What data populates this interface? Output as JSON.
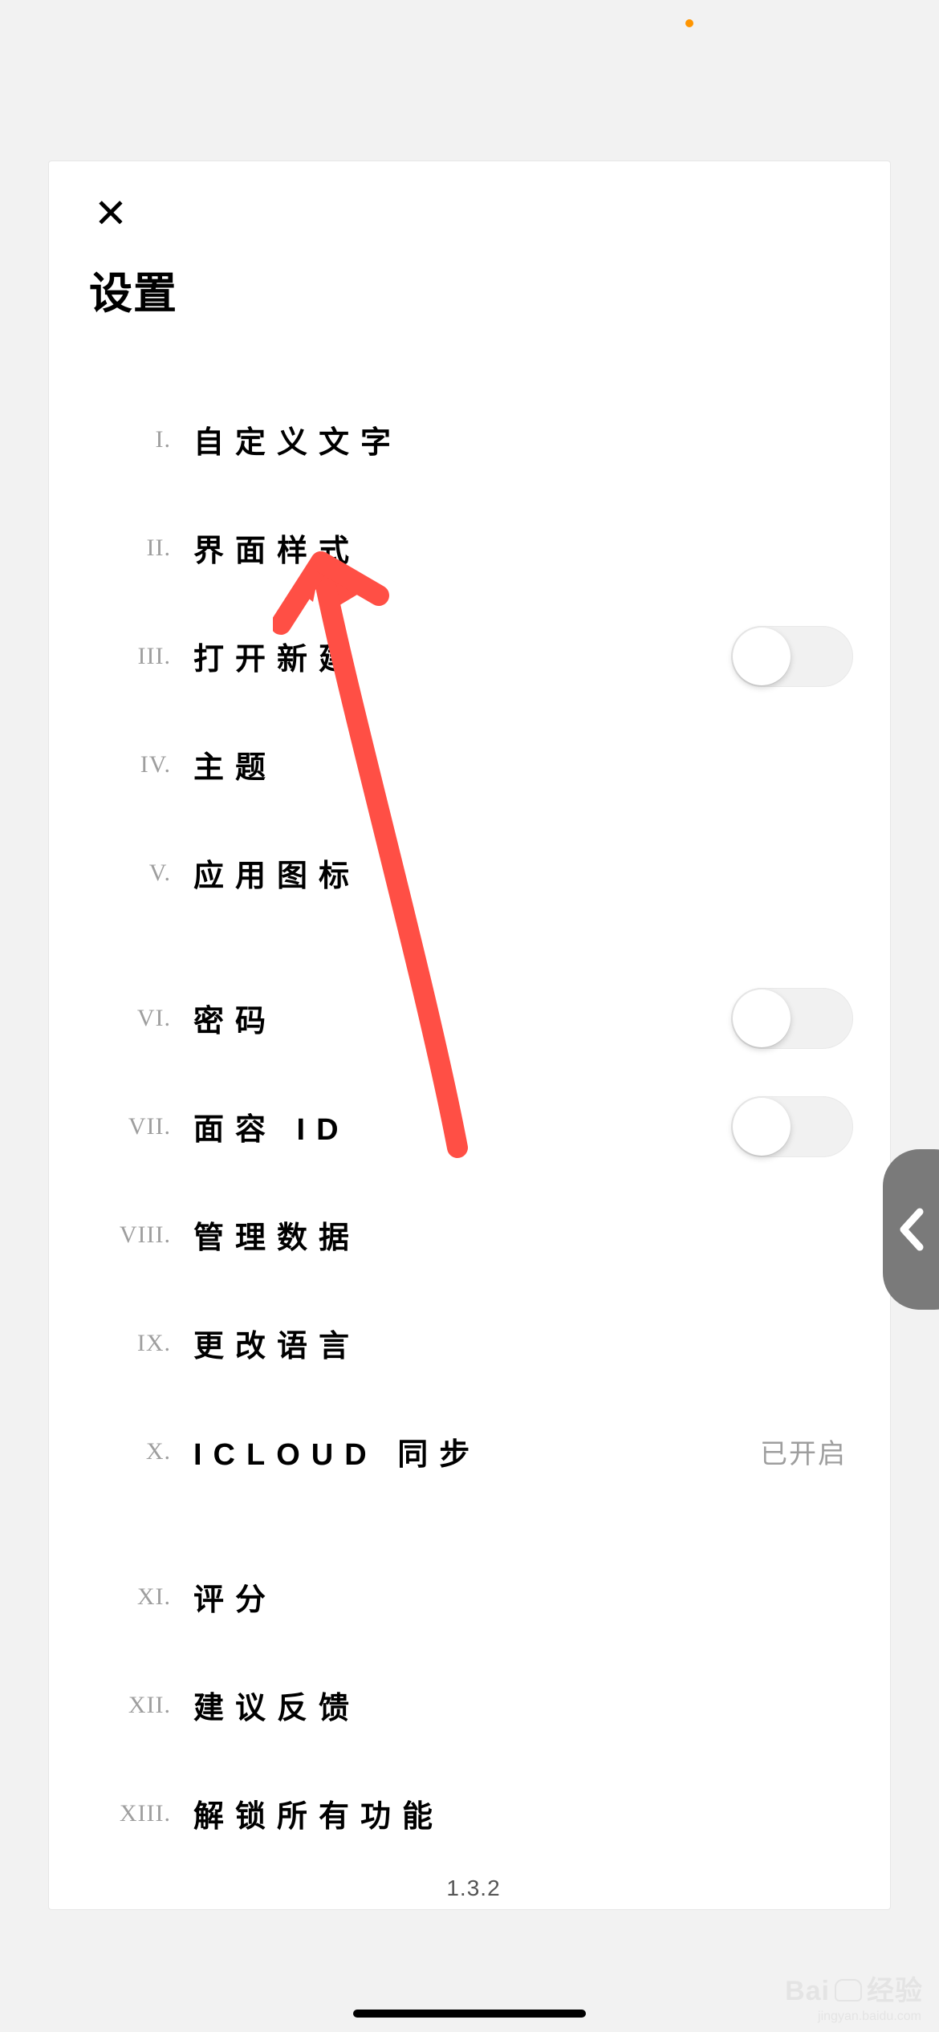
{
  "status": {
    "dot": true
  },
  "header": {
    "close_glyph": "✕",
    "title": "设置"
  },
  "items": [
    {
      "roman": "I.",
      "label": "自定义文字",
      "type": "link"
    },
    {
      "roman": "II.",
      "label": "界面样式",
      "type": "link"
    },
    {
      "roman": "III.",
      "label": "打开新建",
      "type": "toggle",
      "on": false
    },
    {
      "roman": "IV.",
      "label": "主题",
      "type": "link"
    },
    {
      "roman": "V.",
      "label": "应用图标",
      "type": "link"
    },
    {
      "roman": "VI.",
      "label": "密码",
      "type": "toggle",
      "on": false
    },
    {
      "roman": "VII.",
      "label": "面容 ID",
      "type": "toggle",
      "on": false
    },
    {
      "roman": "VIII.",
      "label": "管理数据",
      "type": "link"
    },
    {
      "roman": "IX.",
      "label": "更改语言",
      "type": "link"
    },
    {
      "roman": "X.",
      "label": "ICLOUD 同步",
      "type": "value",
      "value": "已开启"
    },
    {
      "roman": "XI.",
      "label": "评分",
      "type": "link"
    },
    {
      "roman": "XII.",
      "label": "建议反馈",
      "type": "link"
    },
    {
      "roman": "XIII.",
      "label": "解锁所有功能",
      "type": "link"
    }
  ],
  "group_breaks_after": [
    4,
    9
  ],
  "version": "1.3.2",
  "annotation": {
    "arrow_color": "#ff4f45"
  },
  "watermark": {
    "brand_left": "Bai",
    "brand_right": "经验",
    "sub": "jingyan.baidu.com"
  }
}
